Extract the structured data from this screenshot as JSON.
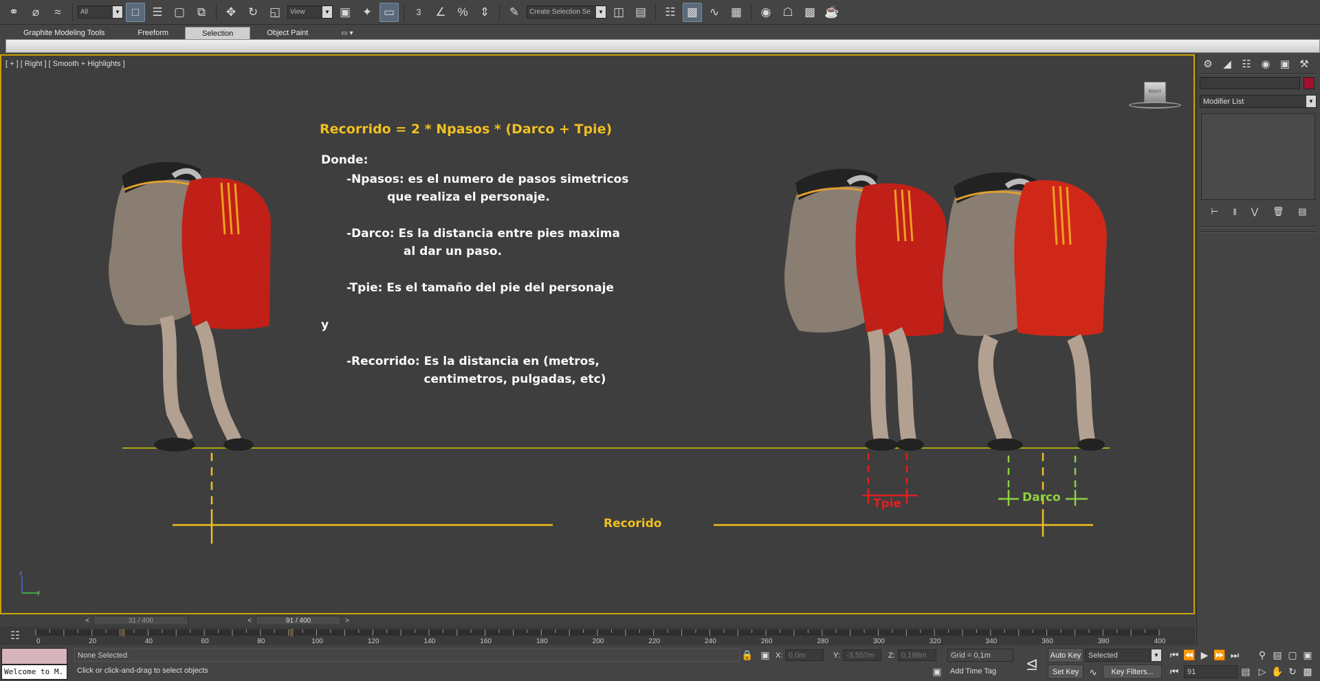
{
  "toolbar": {
    "selection_filter": "All",
    "reference_coord": "View",
    "named_selection_placeholder": "Create Selection Se",
    "snap_label": "3",
    "buttons": [
      {
        "icon": "link-icon"
      },
      {
        "icon": "unlink-icon"
      },
      {
        "icon": "bind-space-warp-icon"
      },
      {
        "icon": "select-object-icon"
      },
      {
        "icon": "select-by-name-icon"
      },
      {
        "icon": "rectangular-selection-icon"
      },
      {
        "icon": "window-crossing-icon"
      },
      {
        "icon": "select-move-icon"
      },
      {
        "icon": "select-rotate-icon"
      },
      {
        "icon": "select-scale-icon"
      }
    ]
  },
  "ribbon": {
    "tabs": [
      {
        "label": "Graphite Modeling Tools",
        "active": false
      },
      {
        "label": "Freeform",
        "active": false
      },
      {
        "label": "Selection",
        "active": true
      },
      {
        "label": "Object Paint",
        "active": false
      }
    ]
  },
  "viewport": {
    "label": "[ + ] [ Right ] [ Smooth + Highlights ]",
    "viewcube_label": "RIGHT",
    "formula": "Recorrido = 2 * Npasos * (Darco + Tpie)",
    "notes": {
      "donde": "Donde:",
      "npasos": "-Npasos: es el numero de pasos simetricos\n          que realiza el personaje.",
      "darco": "-Darco: Es la distancia entre pies maxima\n              al dar un paso.",
      "tpie": "-Tpie: Es el tamaño del pie del personaje",
      "y": "y",
      "recorrido": "-Recorrido: Es la distancia en (metros,\n                   centimetros, pulgadas, etc)"
    },
    "labels": {
      "tpie": "Tpie",
      "darco": "Darco",
      "recorido": "Recorido"
    },
    "colors": {
      "yellow": "#f0c020",
      "red": "#e02020",
      "green": "#8fd040",
      "border": "#c8a200"
    },
    "axis": {
      "y": "y",
      "z": "z"
    }
  },
  "time_slider": {
    "ghost_frame": "31 / 400",
    "current_frame": "91 / 400",
    "prev_arrow": "<",
    "next_arrow": ">"
  },
  "track": {
    "ticks": [
      "0",
      "20",
      "40",
      "60",
      "80",
      "100",
      "120",
      "140",
      "160",
      "180",
      "200",
      "220",
      "240",
      "260",
      "280",
      "300",
      "320",
      "340",
      "360",
      "380",
      "400"
    ],
    "frame_range": [
      0,
      400
    ],
    "current_frame": 91,
    "key_frames": [
      31,
      91
    ]
  },
  "status": {
    "maxscript_text": "Welcome to M.",
    "selection": "None Selected",
    "prompt": "Click or click-and-drag to select objects",
    "x_label": "X:",
    "y_label": "Y:",
    "z_label": "Z:",
    "x_value": "0,0m",
    "y_value": "-3,557m",
    "z_value": "0,198m",
    "grid": "Grid = 0,1m",
    "add_time_tag": "Add Time Tag",
    "auto_key": "Auto Key",
    "set_key": "Set Key",
    "key_mode": "Selected",
    "key_filters": "Key Filters...",
    "frame_field": "91"
  },
  "command_panel": {
    "modifier_list": "Modifier List",
    "object_color": "#a01030"
  }
}
